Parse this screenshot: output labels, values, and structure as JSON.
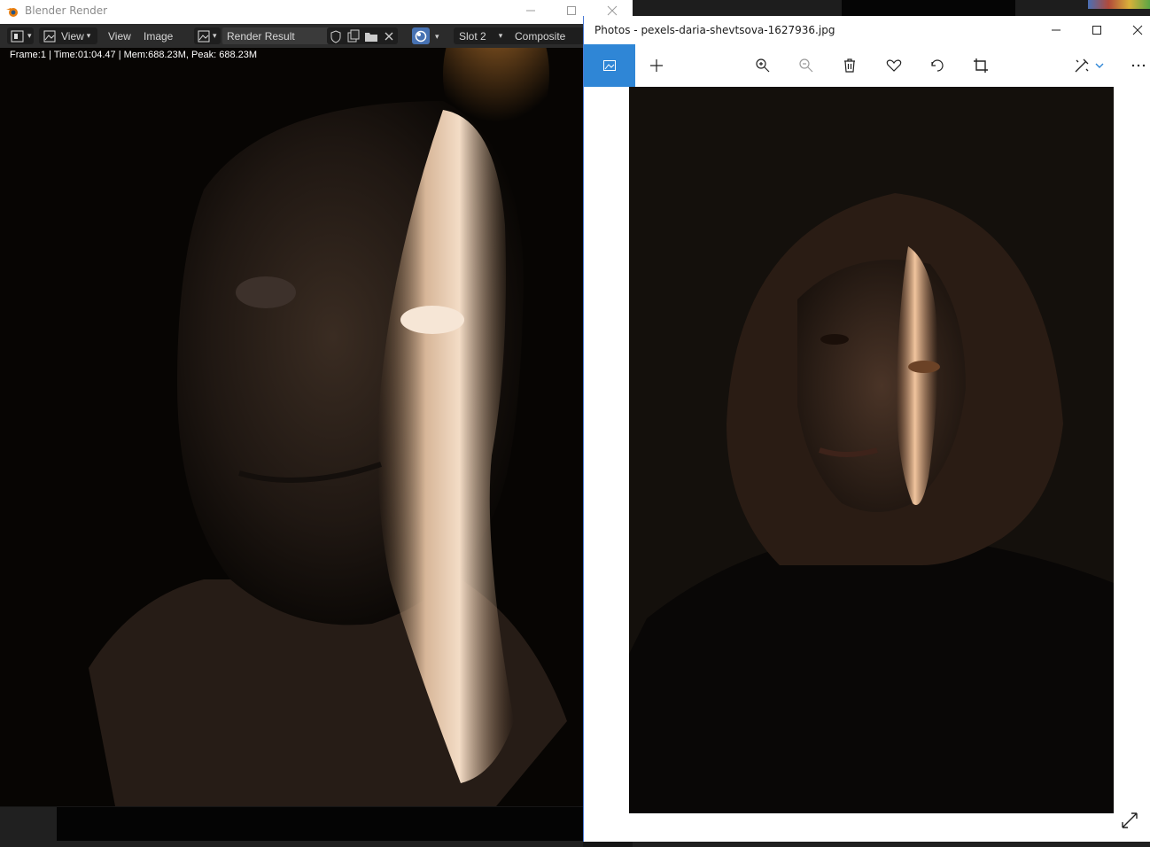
{
  "blender": {
    "window_title": "Blender Render",
    "header": {
      "view_menu_1": "View",
      "view_menu_2": "View",
      "image_menu": "Image",
      "image_name": "Render Result",
      "slot": "Slot 2",
      "layer": "Composite"
    },
    "status": "Frame:1 | Time:01:04.47 | Mem:688.23M, Peak: 688.23M",
    "icons": [
      "blender-logo-icon",
      "editor-type-icon",
      "image-icon",
      "shield-icon",
      "duplicate-icon",
      "folder-icon",
      "close-icon",
      "render-sphere-icon"
    ]
  },
  "photos": {
    "window_title": "Photos - pexels-daria-shevtsova-1627936.jpg",
    "toolbar_icons": [
      "photo-view-icon",
      "add-icon",
      "zoom-in-icon",
      "zoom-out-icon",
      "delete-icon",
      "favorite-icon",
      "rotate-icon",
      "crop-icon",
      "edit-icon",
      "more-icon"
    ],
    "accent_color": "#2f86d6"
  }
}
